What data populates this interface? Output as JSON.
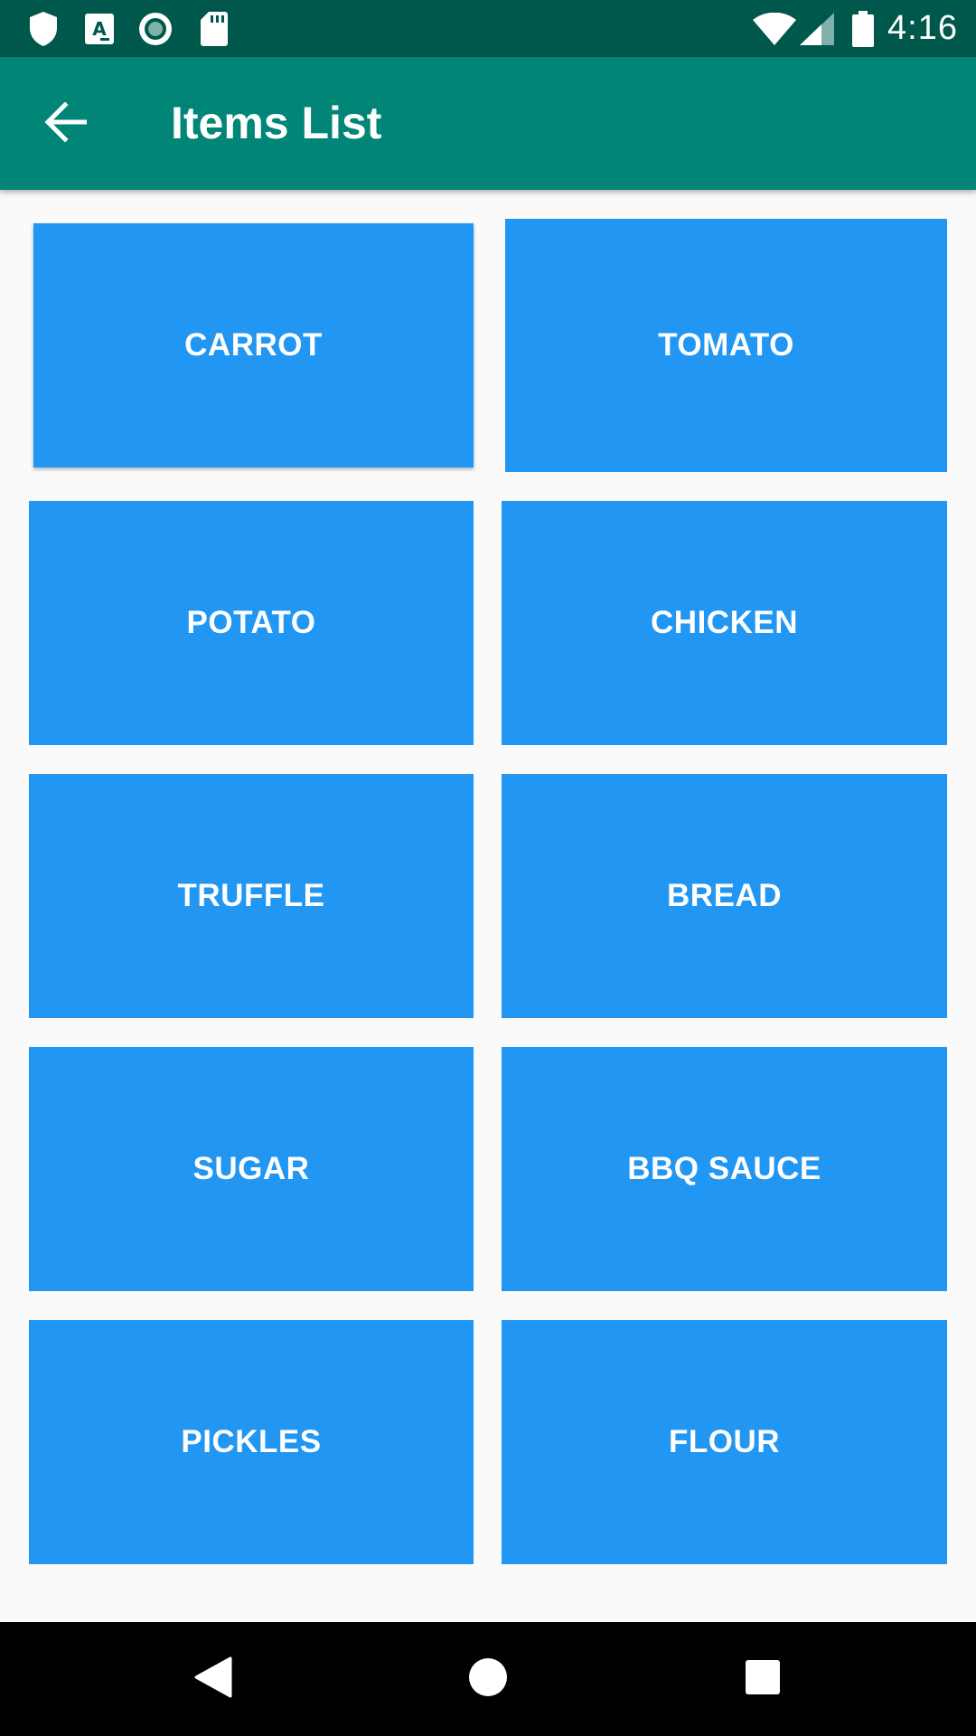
{
  "status_bar": {
    "time": "4:16",
    "icons_left": [
      "shield-icon",
      "text-app-icon",
      "record-icon",
      "sd-card-icon"
    ],
    "icons_right": [
      "wifi-icon",
      "signal-icon",
      "battery-icon"
    ]
  },
  "app_bar": {
    "back_icon": "arrow-back-icon",
    "title": "Items List",
    "color": "#008577"
  },
  "items": [
    "CARROT",
    "TOMATO",
    "POTATO",
    "CHICKEN",
    "TRUFFLE",
    "BREAD",
    "SUGAR",
    "BBQ SAUCE",
    "PICKLES",
    "FLOUR"
  ],
  "item_color": "#2196f3",
  "nav_bar": {
    "buttons": [
      "back-triangle-icon",
      "home-circle-icon",
      "recents-square-icon"
    ]
  }
}
